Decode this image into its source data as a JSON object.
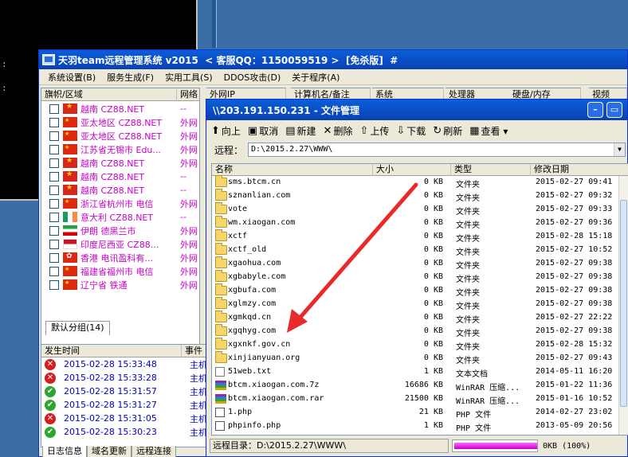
{
  "main_window": {
    "title": "天羽team远程管理系统 v2015  < 客服QQ：1150059519 >  [免杀版]  #",
    "menu": [
      "系统设置(B)",
      "服务生成(F)",
      "实用工具(S)",
      "DDOS攻击(D)",
      "关于程序(A)"
    ],
    "columns": [
      "旗帜/区域",
      "网络",
      "外网IP",
      "计算机名/备注",
      "系统",
      "处理器",
      "硬盘/内存",
      "视频"
    ],
    "clients": [
      {
        "flag": "vn",
        "region": "越南   CZ88.NET",
        "net": "--"
      },
      {
        "flag": "cn",
        "region": "亚太地区   CZ88.NET",
        "net": "外网"
      },
      {
        "flag": "cn",
        "region": "亚太地区   CZ88.NET",
        "net": "外网"
      },
      {
        "flag": "cn",
        "region": "江苏省无锡市 Edu...",
        "net": "外网"
      },
      {
        "flag": "vn",
        "region": "越南   CZ88.NET",
        "net": "外网"
      },
      {
        "flag": "vn",
        "region": "越南   CZ88.NET",
        "net": "--"
      },
      {
        "flag": "vn",
        "region": "越南   CZ88.NET",
        "net": "--"
      },
      {
        "flag": "cn",
        "region": "浙江省杭州市 电信",
        "net": "外网"
      },
      {
        "flag": "ie",
        "region": "意大利   CZ88.NET",
        "net": "--"
      },
      {
        "flag": "ir",
        "region": "伊朗 德黑兰市",
        "net": "外网"
      },
      {
        "flag": "id",
        "region": "印度尼西亚   CZ88...",
        "net": "外网"
      },
      {
        "flag": "hk",
        "region": "香港 电讯盈科有...",
        "net": "外网"
      },
      {
        "flag": "cn",
        "region": "福建省福州市 电信",
        "net": "外网"
      },
      {
        "flag": "cn",
        "region": "辽宁省 铁通",
        "net": "外网"
      }
    ],
    "group_tab": "默认分组(14)",
    "log_columns": [
      "发生时间",
      "事件"
    ],
    "logs": [
      {
        "status": "err",
        "time": "2015-02-28 15:33:48",
        "event": "主机"
      },
      {
        "status": "err",
        "time": "2015-02-28 15:33:28",
        "event": "主机"
      },
      {
        "status": "ok",
        "time": "2015-02-28 15:31:57",
        "event": "主机"
      },
      {
        "status": "ok",
        "time": "2015-02-28 15:31:27",
        "event": "主机"
      },
      {
        "status": "err",
        "time": "2015-02-28 15:31:05",
        "event": "主机"
      },
      {
        "status": "ok",
        "time": "2015-02-28 15:30:23",
        "event": "主机"
      }
    ],
    "bottom_tabs": [
      "日志信息",
      "域名更新",
      "远程连接"
    ]
  },
  "file_manager": {
    "title": "\\\\203.191.150.231 - 文件管理",
    "toolbar": [
      {
        "icon": "up-icon",
        "glyph": "⬆",
        "label": "向上"
      },
      {
        "icon": "cancel-icon",
        "glyph": "▣",
        "label": "取消"
      },
      {
        "icon": "new-icon",
        "glyph": "▤",
        "label": "新建"
      },
      {
        "icon": "delete-icon",
        "glyph": "✕",
        "label": "删除"
      },
      {
        "icon": "upload-icon",
        "glyph": "⇧",
        "label": "上传"
      },
      {
        "icon": "download-icon",
        "glyph": "⇩",
        "label": "下载"
      },
      {
        "icon": "refresh-icon",
        "glyph": "↻",
        "label": "刷新"
      },
      {
        "icon": "view-icon",
        "glyph": "▦",
        "label": "查看 ▾"
      }
    ],
    "path_label": "远程：",
    "path_value": "D:\\2015.2.27\\WWW\\",
    "columns": [
      "名称",
      "大小",
      "类型",
      "修改日期"
    ],
    "files": [
      {
        "icon": "folder",
        "name": "sms.btcm.cn",
        "size": "0 KB",
        "type": "文件夹",
        "date": "2015-02-27 09:41"
      },
      {
        "icon": "folder",
        "name": "sznanlian.com",
        "size": "0 KB",
        "type": "文件夹",
        "date": "2015-02-27 09:32"
      },
      {
        "icon": "folder",
        "name": "vote",
        "size": "0 KB",
        "type": "文件夹",
        "date": "2015-02-27 09:33"
      },
      {
        "icon": "folder",
        "name": "wm.xiaogan.com",
        "size": "0 KB",
        "type": "文件夹",
        "date": "2015-02-27 09:36"
      },
      {
        "icon": "folder",
        "name": "xctf",
        "size": "0 KB",
        "type": "文件夹",
        "date": "2015-02-28 15:18"
      },
      {
        "icon": "folder",
        "name": "xctf_old",
        "size": "0 KB",
        "type": "文件夹",
        "date": "2015-02-27 10:52"
      },
      {
        "icon": "folder",
        "name": "xgaohua.com",
        "size": "0 KB",
        "type": "文件夹",
        "date": "2015-02-27 09:38"
      },
      {
        "icon": "folder",
        "name": "xgbabyle.com",
        "size": "0 KB",
        "type": "文件夹",
        "date": "2015-02-27 09:38"
      },
      {
        "icon": "folder",
        "name": "xgbufa.com",
        "size": "0 KB",
        "type": "文件夹",
        "date": "2015-02-27 09:38"
      },
      {
        "icon": "folder",
        "name": "xglmzy.com",
        "size": "0 KB",
        "type": "文件夹",
        "date": "2015-02-27 09:38"
      },
      {
        "icon": "folder",
        "name": "xgmkqd.cn",
        "size": "0 KB",
        "type": "文件夹",
        "date": "2015-02-27 22:22"
      },
      {
        "icon": "folder",
        "name": "xgqhyg.com",
        "size": "0 KB",
        "type": "文件夹",
        "date": "2015-02-27 09:38"
      },
      {
        "icon": "folder",
        "name": "xgxnkf.gov.cn",
        "size": "0 KB",
        "type": "文件夹",
        "date": "2015-02-28 15:32"
      },
      {
        "icon": "folder",
        "name": "xinjianyuan.org",
        "size": "0 KB",
        "type": "文件夹",
        "date": "2015-02-27 09:43"
      },
      {
        "icon": "txt",
        "name": "51web.txt",
        "size": "1 KB",
        "type": "文本文档",
        "date": "2014-05-11 16:20"
      },
      {
        "icon": "rar",
        "name": "btcm.xiaogan.com.7z",
        "size": "16686 KB",
        "type": "WinRAR 压缩...",
        "date": "2015-01-22 11:36"
      },
      {
        "icon": "rar",
        "name": "btcm.xiaogan.com.rar",
        "size": "21500 KB",
        "type": "WinRAR 压缩...",
        "date": "2015-01-16 10:52"
      },
      {
        "icon": "php",
        "name": "1.php",
        "size": "21 KB",
        "type": "PHP 文件",
        "date": "2014-02-27 23:02"
      },
      {
        "icon": "php",
        "name": "phpinfo.php",
        "size": "1 KB",
        "type": "PHP 文件",
        "date": "2013-05-09 20:56"
      }
    ],
    "status_dir": "远程目录：D:\\2015.2.27\\WWW\\",
    "progress_fraction": 1.0,
    "progress_text": "0KB (100%)"
  },
  "colors": {
    "titlebar": "#0a4cc4",
    "region_text": "#c800c8",
    "log_text": "#0000c8",
    "annotation_arrow": "#e82a2a"
  }
}
